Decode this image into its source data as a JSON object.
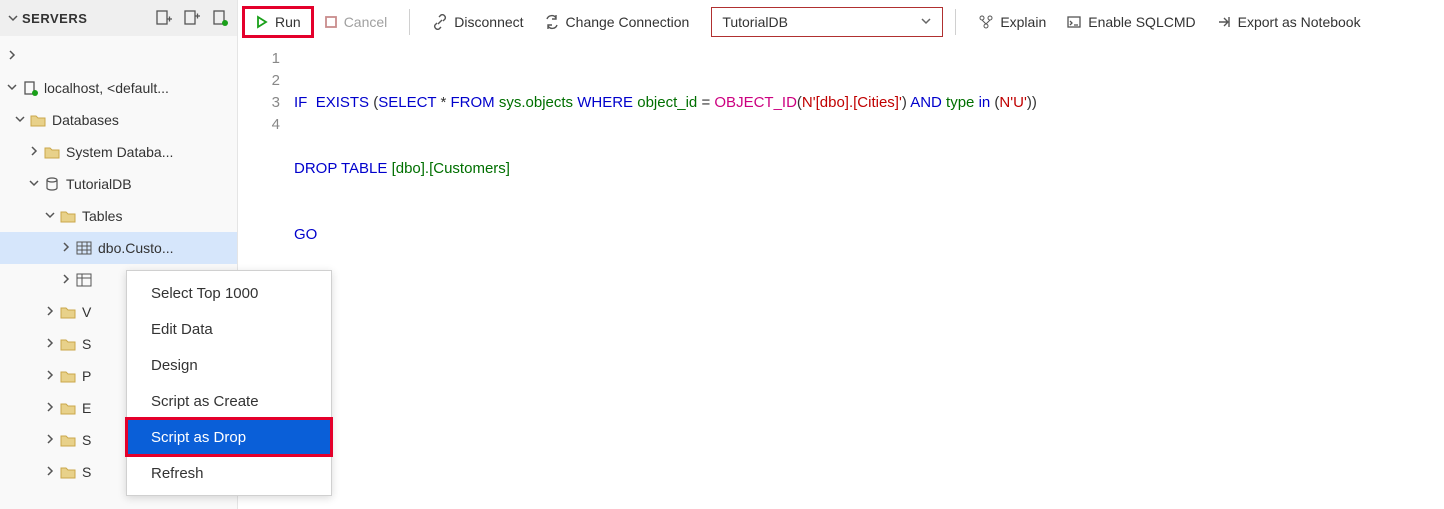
{
  "sidebar": {
    "title": "SERVERS",
    "nodes": {
      "server": "localhost, <default...",
      "databases": "Databases",
      "systemdb": "System Databa...",
      "tutorialdb": "TutorialDB",
      "tables": "Tables",
      "custo": "dbo.Custo...",
      "v": "V",
      "s1": "S",
      "p": "P",
      "e": "E",
      "s2": "S",
      "s3": "S"
    }
  },
  "toolbar": {
    "run": "Run",
    "cancel": "Cancel",
    "disconnect": "Disconnect",
    "change_connection": "Change Connection",
    "db_selected": "TutorialDB",
    "explain": "Explain",
    "sqlcmd": "Enable SQLCMD",
    "notebook": "Export as Notebook"
  },
  "editor": {
    "line1": {
      "if": "IF",
      "exists": "EXISTS",
      "select": "SELECT",
      "star": "*",
      "from": "FROM",
      "sysobjects": "sys.objects",
      "where": "WHERE",
      "object_id_col": "object_id",
      "eq": "=",
      "object_id_fn": "OBJECT_ID",
      "strlit": "N'[dbo].[Cities]'",
      "and": "AND",
      "type": "type",
      "in": "in",
      "ulit": "N'U'"
    },
    "line2": {
      "drop": "DROP",
      "table": "TABLE",
      "target": "[dbo].[Customers]"
    },
    "line3": {
      "go": "GO"
    },
    "gutter": [
      "1",
      "2",
      "3",
      "4"
    ]
  },
  "context_menu": {
    "items": [
      "Select Top 1000",
      "Edit Data",
      "Design",
      "Script as Create",
      "Script as Drop",
      "Refresh"
    ]
  }
}
